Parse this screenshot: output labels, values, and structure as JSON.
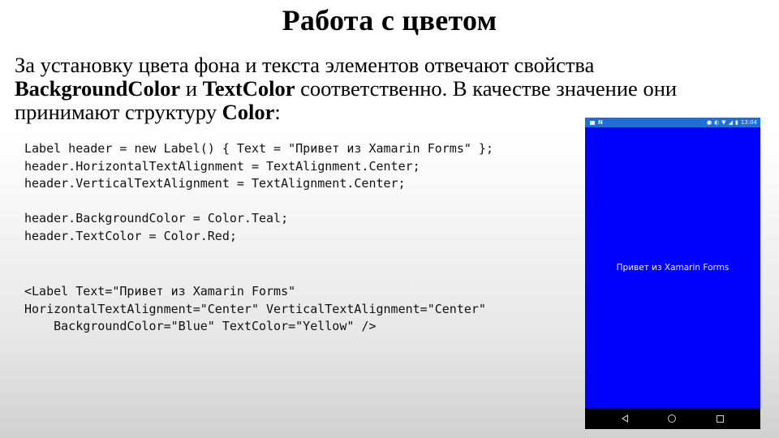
{
  "slide": {
    "title": "Работа с цветом",
    "intro": {
      "part1": "За установку цвета фона и текста элементов отвечают свойства ",
      "prop1": "BackgroundColor",
      "part2": " и ",
      "prop2": "TextColor",
      "part3": " соответственно. В качестве значение они принимают структуру ",
      "prop3": "Color",
      "part4": ":"
    },
    "code_blocks": [
      "Label header = new Label() { Text = \"Привет из Xamarin Forms\" };\nheader.HorizontalTextAlignment = TextAlignment.Center;\nheader.VerticalTextAlignment = TextAlignment.Center;",
      "header.BackgroundColor = Color.Teal;\nheader.TextColor = Color.Red;",
      "<Label Text=\"Привет из Xamarin Forms\"\nHorizontalTextAlignment=\"Center\" VerticalTextAlignment=\"Center\"\n    BackgroundColor=\"Blue\" TextColor=\"Yellow\" />"
    ]
  },
  "phone": {
    "status_bar": {
      "left_icons": [
        "image-icon",
        "n-icon"
      ],
      "right_icons": [
        "location-icon",
        "vibrate-icon",
        "wifi-icon",
        "signal-icon",
        "battery-icon"
      ],
      "time": "13:04"
    },
    "label_text": "Привет из Xamarin Forms",
    "colors": {
      "background": "#0000ff",
      "status_bar": "#1f6fd6",
      "nav_bar": "#000000"
    },
    "nav_buttons": [
      "back",
      "home",
      "recents"
    ]
  }
}
